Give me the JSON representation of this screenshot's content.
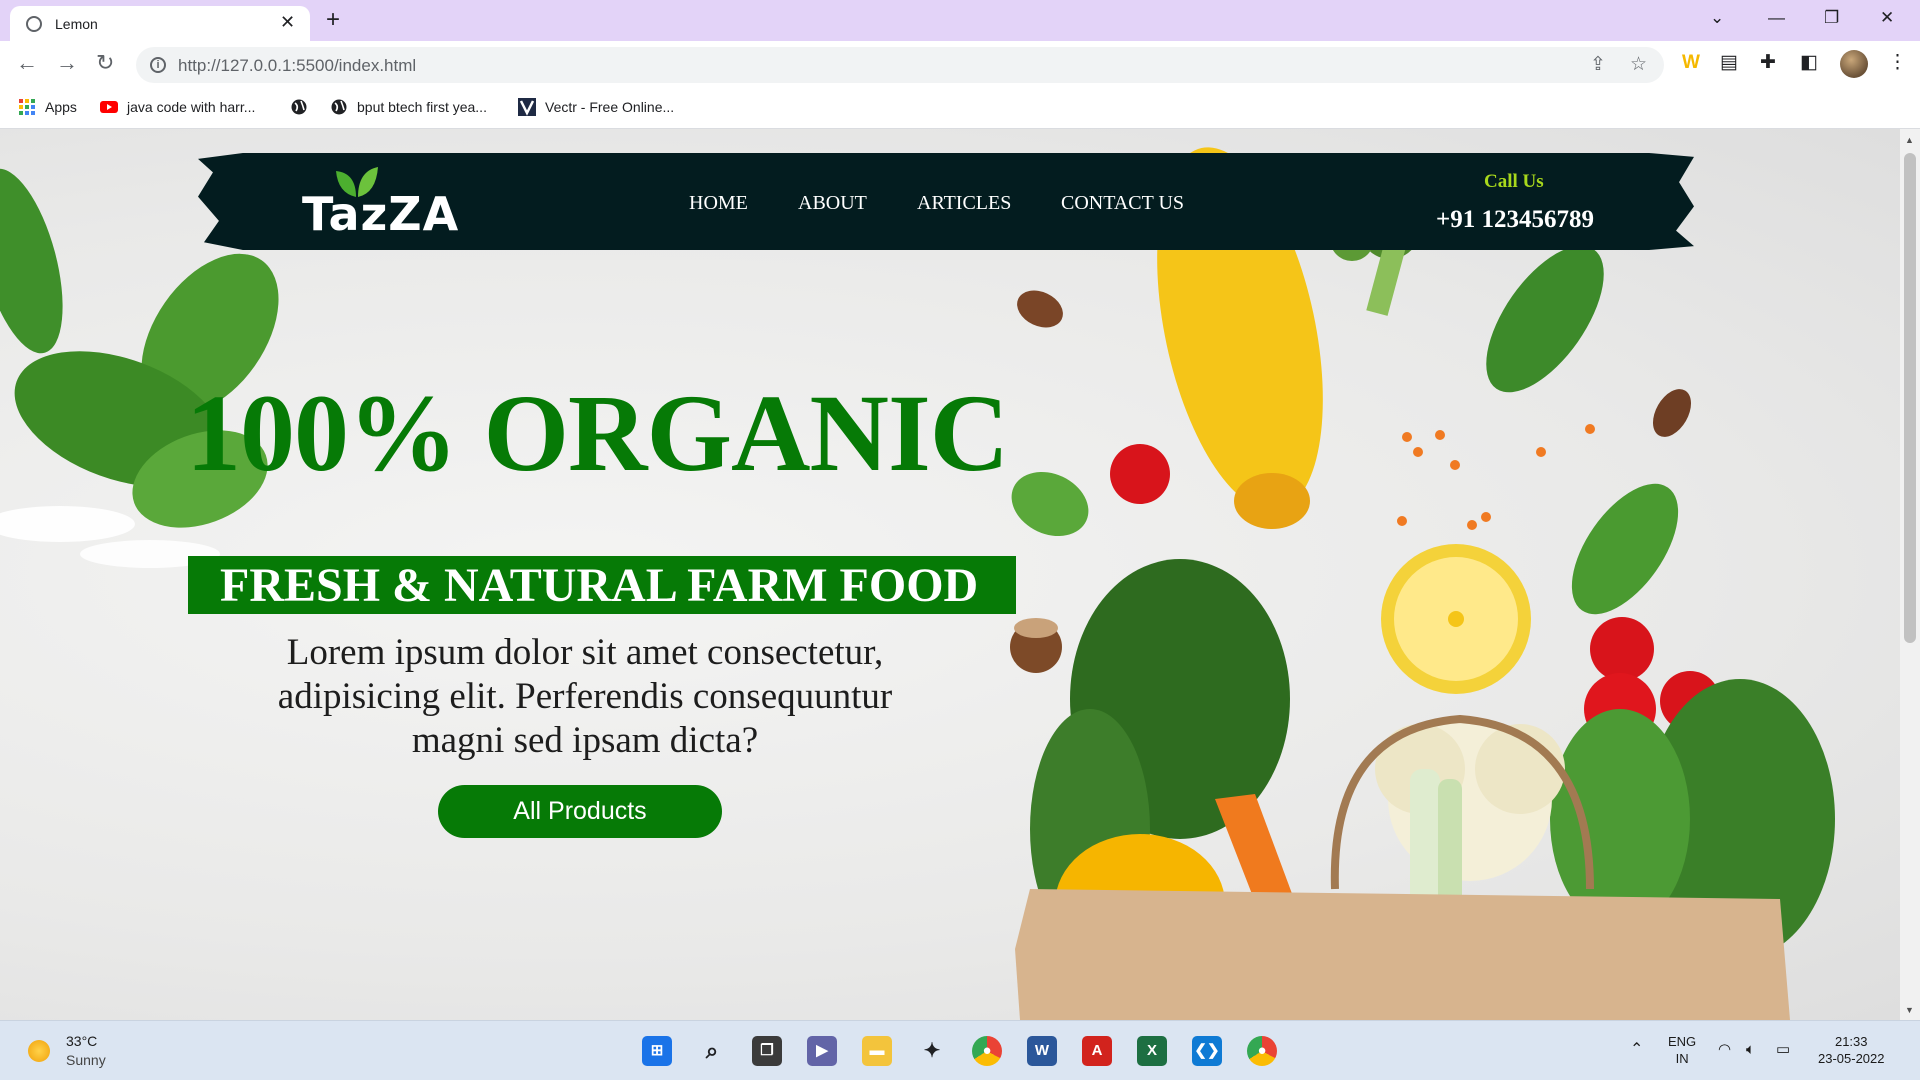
{
  "browser": {
    "tab_title": "Lemon",
    "url": "http://127.0.0.1:5500/index.html",
    "bookmarks": [
      "Apps",
      "java code with harr...",
      "bput btech first yea...",
      "Vectr - Free Online..."
    ]
  },
  "site": {
    "brand": "TazZA",
    "nav": [
      "HOME",
      "ABOUT",
      "ARTICLES",
      "CONTACT US"
    ],
    "call_label": "Call Us",
    "phone": "+91 123456789"
  },
  "hero": {
    "title": "100% ORGANIC",
    "subtitle": "FRESH & NATURAL FARM FOOD",
    "body": "Lorem ipsum dolor sit amet consectetur, adipisicing elit. Perferendis consequuntur magni sed ipsam dicta?",
    "cta": "All Products"
  },
  "taskbar": {
    "temperature": "33°C",
    "weather": "Sunny",
    "lang_1": "ENG",
    "lang_2": "IN",
    "time": "21:33",
    "date": "23-05-2022"
  },
  "colors": {
    "brand_green": "#067a06",
    "nav_bg": "#031c1f",
    "call_green": "#a8d81c"
  }
}
